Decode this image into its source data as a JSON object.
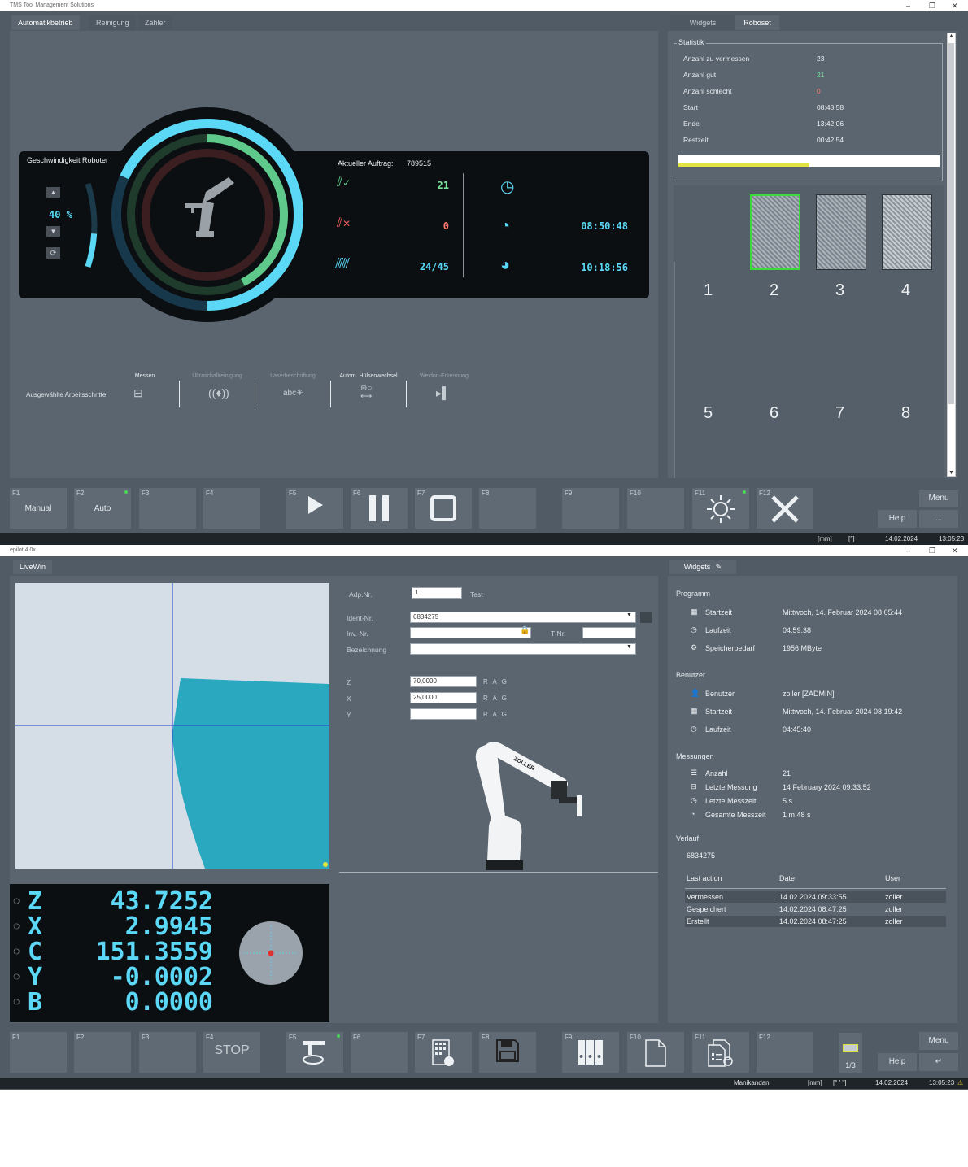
{
  "win1": {
    "title": "TMS Tool Management Solutions",
    "tabs": [
      "Automatikbetrieb",
      "Reinigung",
      "Zähler"
    ],
    "right_tabs": [
      "Widgets",
      "Roboset"
    ],
    "speed": {
      "title": "Geschwindigkeit Roboter",
      "value": "40 %",
      "level": 0.4
    },
    "auftrag": {
      "label": "Aktueller Auftrag:",
      "value": "789515"
    },
    "counts": {
      "good": "21",
      "bad": "0",
      "total": "24/45"
    },
    "times": {
      "t1": "08:50:48",
      "t2": "10:18:56"
    },
    "steps": {
      "label": "Ausgewählte Arbeitsschritte",
      "items": [
        "Messen",
        "Ultraschallreinigung",
        "Laserbeschriftung",
        "Autom. Hülsenwechsel",
        "Weldon-Erkennung"
      ]
    },
    "statistik": {
      "title": "Statistik",
      "rows": [
        {
          "label": "Anzahl zu vermessen",
          "value": "23"
        },
        {
          "label": "Anzahl gut",
          "value": "21"
        },
        {
          "label": "Anzahl schlecht",
          "value": "0"
        },
        {
          "label": "Start",
          "value": "08:48:58"
        },
        {
          "label": "Ende",
          "value": "13:42:06"
        },
        {
          "label": "Restzeit",
          "value": "00:42:54"
        }
      ],
      "progress": 0.5
    },
    "grid_numbers": [
      "1",
      "2",
      "3",
      "4",
      "5",
      "6",
      "7",
      "8"
    ],
    "fkeys": [
      {
        "f": "F1",
        "label": "Manual"
      },
      {
        "f": "F2",
        "label": "Auto"
      },
      {
        "f": "F3",
        "label": ""
      },
      {
        "f": "F4",
        "label": ""
      },
      {
        "f": "F5",
        "icon": "play-icon"
      },
      {
        "f": "F6",
        "icon": "pause-icon"
      },
      {
        "f": "F7",
        "icon": "stop-square-icon"
      },
      {
        "f": "F8",
        "label": ""
      },
      {
        "f": "F9",
        "label": ""
      },
      {
        "f": "F10",
        "label": ""
      },
      {
        "f": "F11",
        "icon": "light-icon"
      },
      {
        "f": "F12",
        "icon": "close-x-icon"
      }
    ],
    "side_buttons": {
      "menu": "Menu",
      "help": "Help",
      "more": "..."
    },
    "status": {
      "unit": "[mm]",
      "angle": "[°]",
      "date": "14.02.2024",
      "time": "13:05:23"
    }
  },
  "win2": {
    "title": "epilot 4.0x",
    "left_tab": "LiveWin",
    "right_tab": "Widgets",
    "form": {
      "adp_label": "Adp.Nr.",
      "adp_value": "1",
      "test_label": "Test",
      "ident_label": "Ident-Nr.",
      "ident_value": "6834275",
      "inv_label": "Inv.-Nr.",
      "t_label": "T-Nr.",
      "bez_label": "Bezeichnung",
      "z_label": "Z",
      "z_value": "70,0000",
      "x_label": "X",
      "x_value": "25,0000",
      "y_label": "Y",
      "y_value": "",
      "rag": "R A G"
    },
    "robot_brand": "ZOLLER",
    "readout": [
      {
        "axis": "Z",
        "value": "43.7252"
      },
      {
        "axis": "X",
        "value": "2.9945"
      },
      {
        "axis": "C",
        "value": "151.3559"
      },
      {
        "axis": "Y",
        "value": "-0.0002"
      },
      {
        "axis": "B",
        "value": "0.0000"
      }
    ],
    "widgets": {
      "programm": "Programm",
      "p_start_label": "Startzeit",
      "p_start": "Mittwoch, 14. Februar 2024 08:05:44",
      "p_lauf_label": "Laufzeit",
      "p_lauf": "04:59:38",
      "p_speicher_label": "Speicherbedarf",
      "p_speicher": "1956 MByte",
      "benutzer": "Benutzer",
      "b_user_label": "Benutzer",
      "b_user": "zoller [ZADMIN]",
      "b_start_label": "Startzeit",
      "b_start": "Mittwoch, 14. Februar 2024 08:19:42",
      "b_lauf_label": "Laufzeit",
      "b_lauf": "04:45:40",
      "messungen": "Messungen",
      "m_anzahl_label": "Anzahl",
      "m_anzahl": "21",
      "m_letzte_label": "Letzte Messung",
      "m_letzte": "14 February 2024 09:33:52",
      "m_zeit_label": "Letzte Messzeit",
      "m_zeit": "5 s",
      "m_gesamt_label": "Gesamte Messzeit",
      "m_gesamt": "1 m 48 s",
      "verlauf": "Verlauf",
      "verlauf_id": "6834275",
      "table_headers": [
        "Last action",
        "Date",
        "User"
      ],
      "table_rows": [
        [
          "Vermessen",
          "14.02.2024 09:33:55",
          "zoller"
        ],
        [
          "Gespeichert",
          "14.02.2024 08:47:25",
          "zoller"
        ],
        [
          "Erstellt",
          "14.02.2024 08:47:25",
          "zoller"
        ]
      ]
    },
    "fkeys": [
      {
        "f": "F1"
      },
      {
        "f": "F2"
      },
      {
        "f": "F3"
      },
      {
        "f": "F4",
        "label": "STOP"
      },
      {
        "f": "F5",
        "icon": "measure-rotate-icon"
      },
      {
        "f": "F6"
      },
      {
        "f": "F7",
        "icon": "grid-edit-icon"
      },
      {
        "f": "F8",
        "icon": "save-icon"
      },
      {
        "f": "F9",
        "icon": "binders-icon"
      },
      {
        "f": "F10",
        "icon": "document-icon"
      },
      {
        "f": "F11",
        "icon": "documents-icon"
      },
      {
        "f": "F12"
      }
    ],
    "page": "1/3",
    "side_buttons": {
      "menu": "Menu",
      "help": "Help",
      "enter": "↵"
    },
    "status": {
      "user": "Manikandan",
      "unit": "[mm]",
      "angle": "[° ' \"]",
      "date": "14.02.2024",
      "time": "13:05:23"
    }
  }
}
